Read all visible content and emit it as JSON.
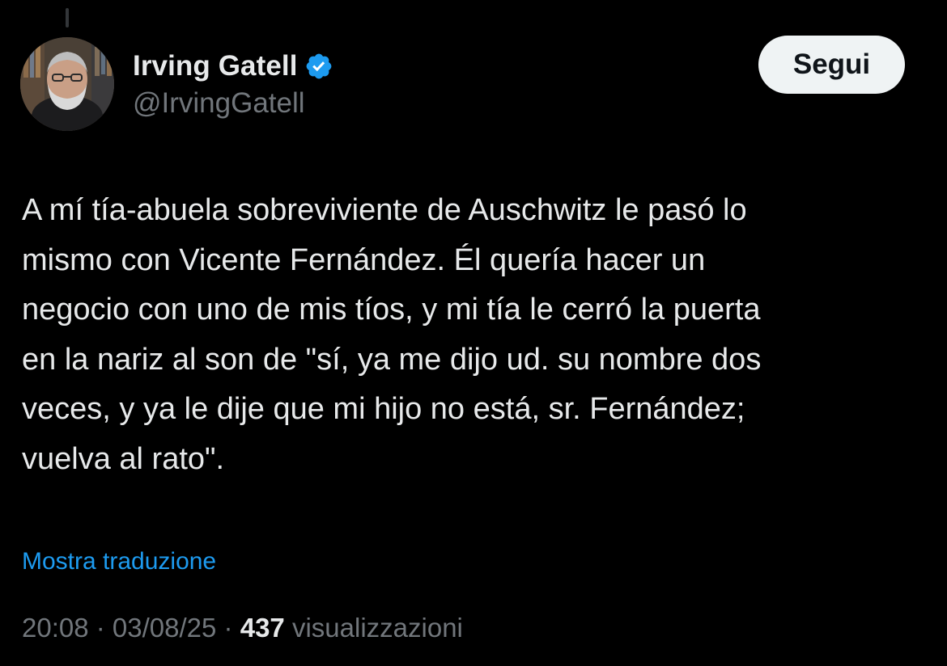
{
  "author": {
    "display_name": "Irving Gatell",
    "handle": "@IrvingGatell",
    "verified": true,
    "verified_icon": "verified-badge-icon",
    "avatar": "profile-photo"
  },
  "follow_button": {
    "label": "Segui"
  },
  "tweet": {
    "text": "A mí tía-abuela sobreviviente de Auschwitz le pasó lo\nmismo con Vicente Fernández. Él quería hacer un\nnegocio con uno de mis tíos, y mi tía le cerró la puerta\nen la nariz al son de \"sí, ya me dijo ud. su nombre dos\nveces, y ya le dije que mi hijo no está, sr. Fernández;\nvuelva al rato\".",
    "translate_label": "Mostra traduzione"
  },
  "meta": {
    "time": "20:08",
    "separator": " · ",
    "date": "03/08/25",
    "views_count": "437",
    "views_label": "visualizzazioni"
  },
  "colors": {
    "background": "#000000",
    "primary_text": "#e7e9ea",
    "secondary_text": "#71767b",
    "link": "#1d9bf0",
    "verified": "#1d9bf0",
    "button_bg": "#eff3f4",
    "button_text": "#0f1419"
  }
}
